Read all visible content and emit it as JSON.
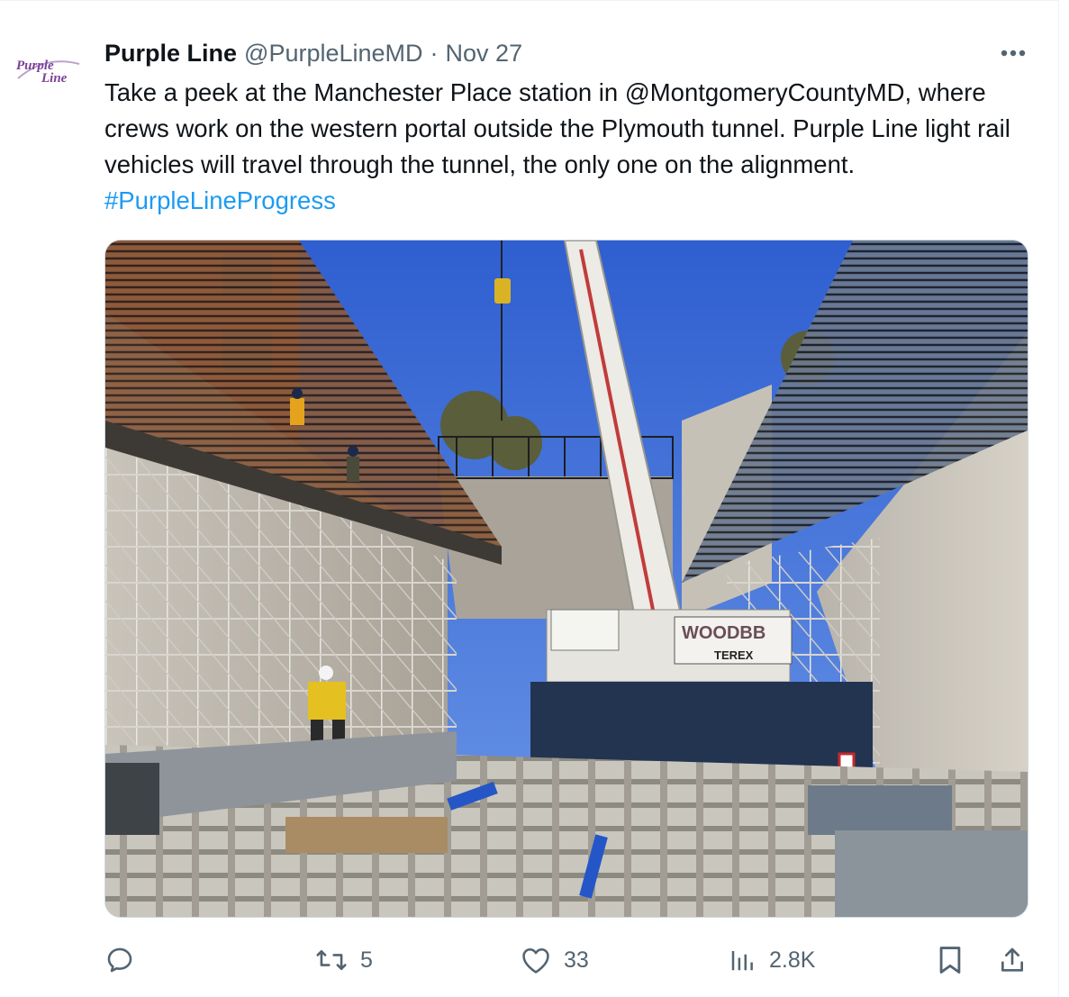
{
  "account": {
    "display_name": "Purple Line",
    "handle": "@PurpleLineMD",
    "separator": "·",
    "date": "Nov 27",
    "logo_text_top": "Purple",
    "logo_text_bottom": "Line",
    "brand_color": "#7b3f98"
  },
  "tweet": {
    "text": "Take a peek at the Manchester Place station in @MontgomeryCountyMD, where crews work on the western portal outside the Plymouth tunnel. Purple Line light rail vehicles will travel through the tunnel, the only one on the alignment.",
    "hashtag": "#PurpleLineProgress",
    "link_color": "#1d9bf0"
  },
  "media": {
    "crane_brand": "WOODBB",
    "crane_model": "TEREX"
  },
  "actions": {
    "reply_icon": "reply-icon",
    "retweet_count": "5",
    "like_count": "33",
    "views_count": "2.8K",
    "bookmark_icon": "bookmark-icon",
    "share_icon": "share-icon",
    "more_icon": "more-icon"
  }
}
